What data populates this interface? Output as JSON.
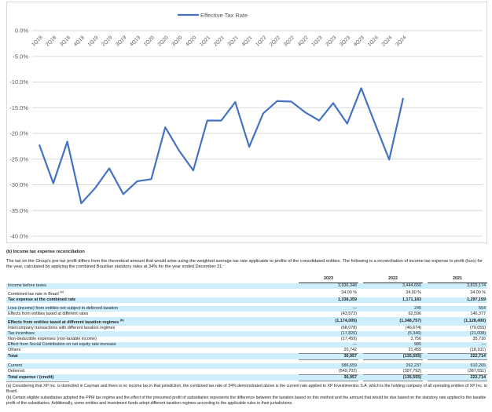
{
  "chart_data": {
    "type": "line",
    "title": "",
    "legend": [
      "Effective Tax Rate"
    ],
    "legend_position": "top",
    "series": [
      {
        "name": "Effective Tax Rate",
        "color": "#4472c4",
        "values": [
          -22.2,
          -29.7,
          -21.6,
          -33.6,
          -30.6,
          -26.8,
          -31.8,
          -29.3,
          -28.9,
          -18.8,
          -23.4,
          -27.2,
          -17.5,
          -17.5,
          -13.9,
          -22.6,
          -16.1,
          -13.7,
          -13.8,
          -15.9,
          -17.5,
          -14.1,
          -18.1,
          -11.2,
          -18.2,
          -25.1,
          -13.1
        ]
      }
    ],
    "categories": [
      "1Q18",
      "2Q18",
      "3Q18",
      "4Q18",
      "1Q19",
      "2Q19",
      "3Q19",
      "4Q19",
      "1Q20",
      "2Q20",
      "3Q20",
      "4Q20",
      "1Q21",
      "2Q21",
      "3Q21",
      "4Q21",
      "1Q22",
      "2Q22",
      "3Q22",
      "4Q22",
      "1Q23",
      "2Q23",
      "3Q23",
      "4Q23",
      "1Q24",
      "2Q24",
      "3Q24"
    ],
    "yticks": [
      "0.0%",
      "-5.0%",
      "-10.0%",
      "-15.0%",
      "-20.0%",
      "-25.0%",
      "-30.0%",
      "-35.0%",
      "-40.0%"
    ],
    "ylim": [
      -40,
      0
    ],
    "grid": true,
    "xlabel": "",
    "ylabel": ""
  },
  "doc": {
    "heading": "(b)   Income tax expense reconciliation",
    "intro": "The tax on the Group's pre-tax profit differs from the theoretical amount that would arise using the weighted average tax rate applicable to profits of the consolidated entities. The following is a reconciliation of income tax expense to profit (loss) for the year, calculated by applying the combined Brazilian statutory rates at 34% for the year ended December 31:",
    "years": [
      "2023",
      "2022",
      "2021"
    ],
    "rows": [
      {
        "label": "Income before taxes",
        "sup": "",
        "v": [
          "3,936,348",
          "3,444,656",
          "3,815,174"
        ]
      },
      {
        "label": "Combined tax rate in Brazil",
        "sup": "(a)",
        "v": [
          "34.00 %",
          "34.00 %",
          "34.00 %"
        ]
      },
      {
        "label": "Tax expense at the combined rate",
        "sup": "",
        "v": [
          "1,338,359",
          "1,171,183",
          "1,297,159"
        ]
      },
      {
        "label": "Loss (income) from entities not subject to deferred taxation",
        "sup": "",
        "v": [
          "—",
          "245",
          "554"
        ]
      },
      {
        "label": "Effects from entities taxed at different rates",
        "sup": "",
        "v": [
          "(43,572)",
          "62,596",
          "146,377"
        ]
      },
      {
        "label": "Effects from entities taxed at different taxation regimes",
        "sup": "(b)",
        "v": [
          "(1,174,005)",
          "(1,348,757)",
          "(1,128,400)"
        ]
      },
      {
        "label": "Intercompany transactions with different taxation regimes",
        "sup": "",
        "v": [
          "(68,078)",
          "(46,674)",
          "(79,055)"
        ]
      },
      {
        "label": "Tax incentives",
        "sup": "",
        "v": [
          "(17,826)",
          "(5,346)",
          "(21,008)"
        ]
      },
      {
        "label": "Non-deductible expenses (non-taxable income)",
        "sup": "",
        "v": [
          "(17,459)",
          "3,756",
          "35,716"
        ]
      },
      {
        "label": "Effect from Social Contribution on net equity rate increase",
        "sup": "",
        "v": [
          "—",
          "985",
          "—"
        ]
      },
      {
        "label": "Others",
        "sup": "",
        "v": [
          "20,742",
          "21,455",
          "(18,101)"
        ]
      },
      {
        "label": "Total",
        "sup": "",
        "v": [
          "36,957",
          "(135,555)",
          "222,714"
        ]
      },
      {
        "label": "Current",
        "sup": "",
        "v": [
          "586,659",
          "262,237",
          "610,265"
        ]
      },
      {
        "label": "Deferred",
        "sup": "",
        "v": [
          "(549,702)",
          "(397,792)",
          "(387,551)"
        ]
      },
      {
        "label": "Total expense / (credit)",
        "sup": "",
        "v": [
          "36,957",
          "(135,555)",
          "222,714"
        ]
      }
    ],
    "footnotes": [
      "(a)  Considering that XP Inc. is domiciled in Cayman and there is no income tax in that jurisdiction, the combined tax rate of 34% demonstrated above is the current rate applied to XP Investimentos S.A. which is the holding company of all operating entities of XP Inc. in Brazil.",
      "(b)  Certain eligible subsidiaries adopted the PPM tax regime and the effect of the presumed profit of subsidiaries represents the difference between the taxation based on this method and the amount that would be due based on the statutory rate applied to the taxable profit of the subsidiaries. Additionally, some entities and investment funds adopt different taxation regimes according to the applicable rules in their jurisdictions."
    ]
  }
}
